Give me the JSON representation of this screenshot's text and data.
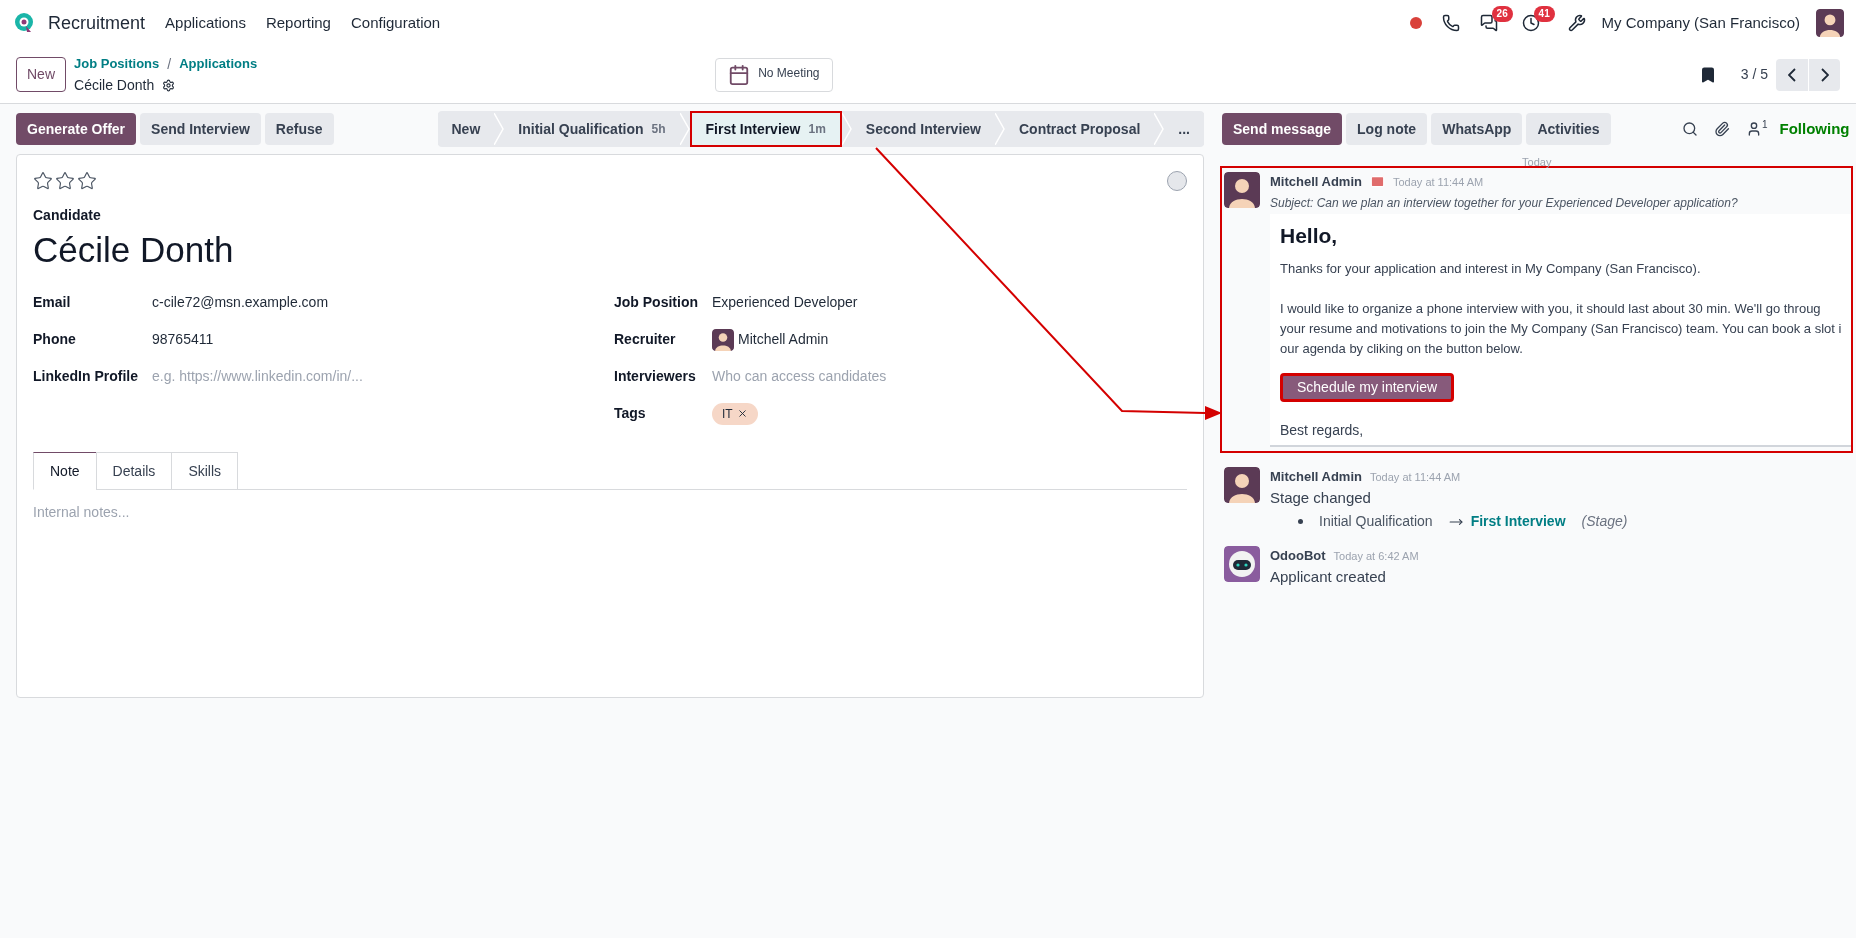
{
  "navbar": {
    "app_name": "Recruitment",
    "menus": [
      "Applications",
      "Reporting",
      "Configuration"
    ],
    "messages_count": "26",
    "activities_count": "41",
    "company": "My Company (San Francisco)"
  },
  "control_panel": {
    "new_button": "New",
    "breadcrumbs": [
      "Job Positions",
      "Applications"
    ],
    "breadcrumb_separator": "/",
    "record_name": "Cécile Donth",
    "meeting": "No Meeting",
    "pager": "3 / 5"
  },
  "actions": [
    {
      "label": "Generate Offer",
      "kind": "primary"
    },
    {
      "label": "Send Interview",
      "kind": "secondary"
    },
    {
      "label": "Refuse",
      "kind": "secondary"
    }
  ],
  "stages": [
    {
      "label": "New",
      "selected": false,
      "highlighted": false
    },
    {
      "label": "Initial Qualification",
      "duration": "5h",
      "selected": false,
      "highlighted": false
    },
    {
      "label": "First Interview",
      "duration": "1m",
      "selected": true,
      "highlighted": true
    },
    {
      "label": "Second Interview",
      "selected": false,
      "highlighted": false
    },
    {
      "label": "Contract Proposal",
      "selected": false,
      "highlighted": false
    },
    {
      "label": "...",
      "selected": false,
      "highlighted": false
    }
  ],
  "form": {
    "stars": 0,
    "candidate_label": "Candidate",
    "name": "Cécile Donth",
    "left_fields": [
      {
        "label": "Email",
        "value": "c-cile72@msn.example.com"
      },
      {
        "label": "Phone",
        "value": "98765411"
      },
      {
        "label": "LinkedIn Profile",
        "placeholder": "e.g. https://www.linkedin.com/in/..."
      }
    ],
    "right_fields": [
      {
        "label": "Job Position",
        "kind": "text",
        "value": "Experienced Developer"
      },
      {
        "label": "Recruiter",
        "kind": "user",
        "value": "Mitchell Admin"
      },
      {
        "label": "Interviewers",
        "kind": "text",
        "placeholder": "Who can access candidates"
      },
      {
        "label": "Tags",
        "kind": "tags",
        "tags": [
          "IT"
        ]
      }
    ],
    "tabs": [
      {
        "label": "Note",
        "selected": true
      },
      {
        "label": "Details",
        "selected": false
      },
      {
        "label": "Skills",
        "selected": false
      }
    ],
    "note_placeholder": "Internal notes..."
  },
  "chatter": {
    "buttons": [
      {
        "label": "Send message",
        "kind": "primary"
      },
      {
        "label": "Log note",
        "kind": "secondary"
      },
      {
        "label": "WhatsApp",
        "kind": "secondary"
      },
      {
        "label": "Activities",
        "kind": "secondary"
      }
    ],
    "follower_count": "1",
    "following": "Following",
    "date_separator": "Today",
    "messages": [
      {
        "kind": "email",
        "author": "Mitchell Admin",
        "time": "Today at 11:44 AM",
        "highlighted": true,
        "subject": "Subject: Can we plan an interview together for your Experienced Developer application?",
        "greeting": "Hello,",
        "paragraphs": [
          [
            "Thanks for your application and interest in My Company (San Francisco)."
          ],
          [
            "I would like to organize a phone interview with you, it should last about 30 min. We'll go throug",
            "your resume and motivations to join the My Company (San Francisco) team. You can book a slot i",
            "our agenda by cliking on the button below."
          ]
        ],
        "button": {
          "label": "Schedule my interview",
          "highlighted": true
        },
        "closing": "Best regards,"
      },
      {
        "kind": "tracking",
        "author": "Mitchell Admin",
        "time": "Today at 11:44 AM",
        "body": "Stage changed",
        "old_value": "Initial Qualification",
        "new_value": "First Interview",
        "field": "(Stage)"
      },
      {
        "kind": "note",
        "author": "OdooBot",
        "time": "Today at 6:42 AM",
        "body": "Applicant created"
      }
    ]
  }
}
